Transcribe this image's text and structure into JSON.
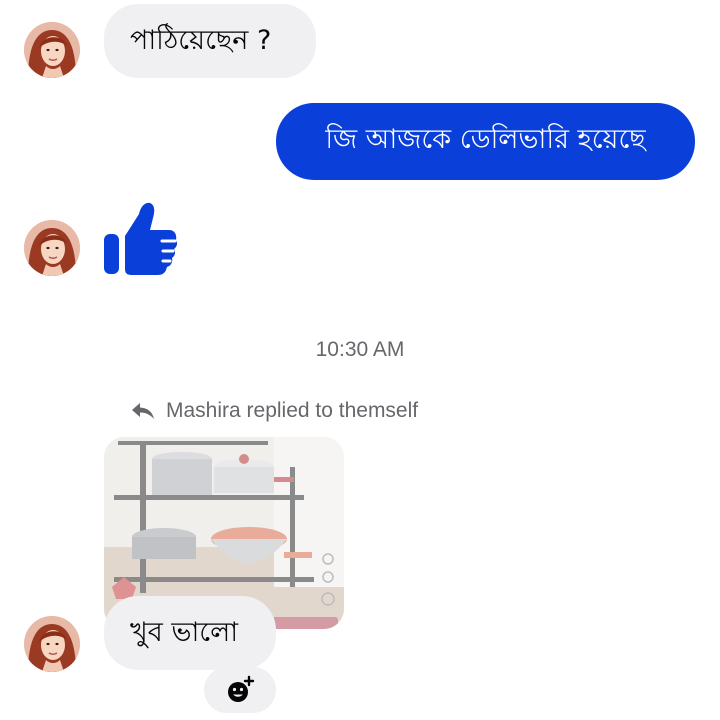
{
  "thread": {
    "messages": [
      {
        "sender": "contact",
        "text": "পাঠিয়েছেন ?"
      },
      {
        "sender": "me",
        "text": "জি আজকে ডেলিভারি হয়েছে"
      },
      {
        "sender": "contact",
        "type": "like-sticker",
        "icon": "thumbs-up-icon"
      },
      {
        "sender": "contact",
        "text": "খুব ভালো"
      }
    ],
    "timestamp": "10:30 AM",
    "reply_context": {
      "text": "Mashira replied to themself",
      "icon": "reply-arrow-icon",
      "image_icon": "cookware-rack-photo"
    },
    "reaction_button_icon": "add-reaction-icon"
  },
  "colors": {
    "outgoing_bubble": "#0a40d9",
    "incoming_bubble": "#f0f0f3",
    "meta_text": "#65676b"
  }
}
